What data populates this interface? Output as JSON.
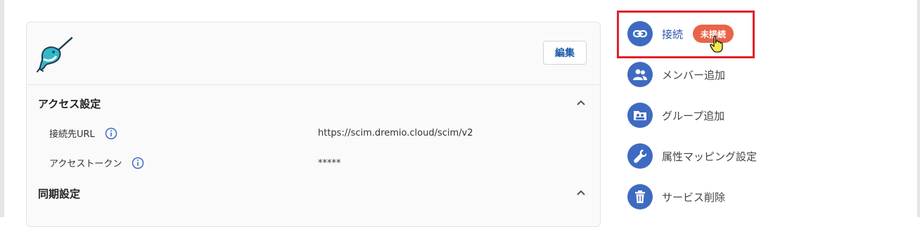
{
  "card": {
    "edit_label": "編集",
    "sections": [
      {
        "title": "アクセス設定",
        "fields": [
          {
            "label": "接続先URL",
            "value": "https://scim.dremio.cloud/scim/v2"
          },
          {
            "label": "アクセストークン",
            "value": "*****"
          }
        ]
      },
      {
        "title": "同期設定"
      }
    ]
  },
  "actions": {
    "connect": {
      "label": "接続",
      "badge": "未接続",
      "icon": "link-icon"
    },
    "add_member": {
      "label": "メンバー追加",
      "icon": "people-icon"
    },
    "add_group": {
      "label": "グループ追加",
      "icon": "group-folder-icon"
    },
    "attribute_mapping": {
      "label": "属性マッピング設定",
      "icon": "wrench-icon"
    },
    "delete_service": {
      "label": "サービス削除",
      "icon": "trash-icon"
    }
  },
  "colors": {
    "accent_blue": "#3e6bc1",
    "badge_orange": "#e8654a",
    "highlight_red": "#e0212a"
  }
}
